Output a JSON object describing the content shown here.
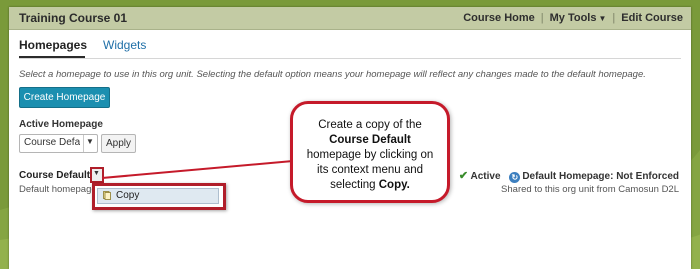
{
  "header": {
    "course_title": "Training Course 01",
    "links": [
      "Course Home",
      "My Tools",
      "Edit Course"
    ],
    "my_tools_icon": "caret-down-icon"
  },
  "tabs": [
    {
      "label": "Homepages",
      "active": true
    },
    {
      "label": "Widgets",
      "active": false
    }
  ],
  "description": "Select a homepage to use in this org unit. Selecting the default option means your homepage will reflect any changes made to the default homepage.",
  "create_button": "Create Homepage",
  "active_homepage": {
    "label": "Active Homepage",
    "selected": "Course Default",
    "apply_label": "Apply"
  },
  "homepage_row": {
    "title": "Course Default",
    "description": "Default homepage",
    "status_active": "Active",
    "status_default": "Default Homepage: Not Enforced",
    "shared_text": "Shared to this org unit from Camosun D2L"
  },
  "context_menu": {
    "items": [
      {
        "label": "Copy",
        "icon": "copy-icon"
      }
    ]
  },
  "callout": {
    "line1": "Create a copy of the",
    "bold1": "Course Default",
    "line2": "homepage by clicking on its context menu and selecting",
    "bold2": "Copy."
  },
  "colors": {
    "frame_green": "#7a9a3a",
    "header_bg": "#c3cba4",
    "primary_button": "#1b8fb0",
    "tab_link": "#1f6fa7",
    "highlight_red": "#c51a2a",
    "check_green": "#3a8c2c"
  }
}
